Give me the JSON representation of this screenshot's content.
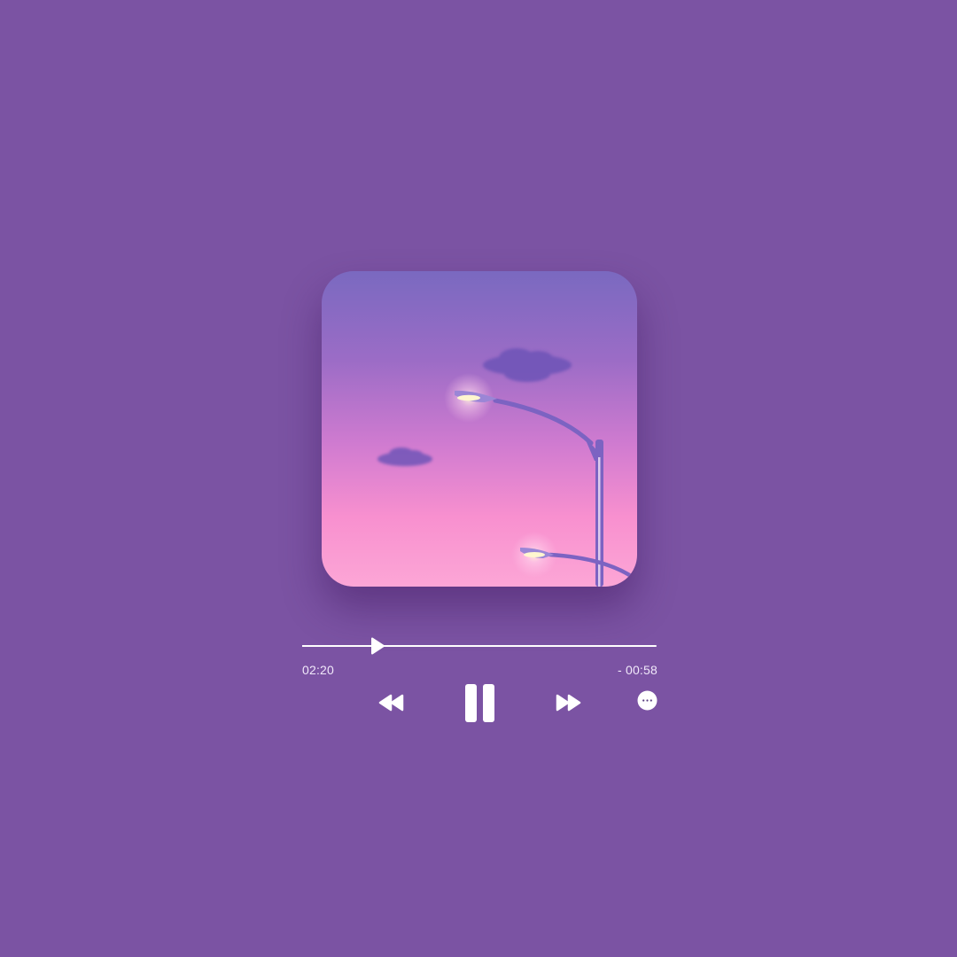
{
  "player": {
    "artwork_name": "album-artwork",
    "progress_fraction": 0.205,
    "time_elapsed": "02:20",
    "time_remaining": "- 00:58",
    "icons": {
      "rewind": "rewind-icon",
      "pause": "pause-icon",
      "forward": "fast-forward-icon",
      "more": "more-options-icon"
    },
    "colors": {
      "background": "#7b53a3",
      "foreground": "#ffffff"
    }
  }
}
